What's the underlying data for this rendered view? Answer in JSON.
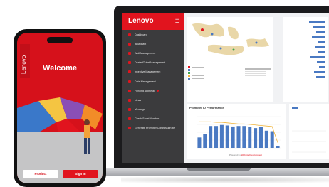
{
  "laptop": {
    "brand": "Lenovo",
    "menu_icon": "hamburger-icon",
    "nav_items": [
      "Dashboard",
      "Broadcast",
      "Wolf Management",
      "Dealer/Outlet Management",
      "Incentive Management",
      "Data Management",
      "Funding Approval",
      "News",
      "Message",
      "Check Serial Number",
      "Generate Promoter Commission file"
    ],
    "chart_panel": {
      "title": "Promoter ID Performance",
      "footer_prefix": "Powered by",
      "footer_link": "Website Development"
    }
  },
  "phone": {
    "brand": "Lenovo",
    "welcome": "Welcome",
    "product_button": "Product",
    "signin_button": "Sign In"
  },
  "colors": {
    "brand_red": "#e1141e",
    "sidebar_bg": "#3b3b3d",
    "bar_blue": "#4a79c2",
    "line_yellow": "#f0b43a"
  },
  "chart_data": {
    "type": "bar",
    "categories": [
      "1",
      "2",
      "3",
      "4",
      "5",
      "6",
      "7",
      "8",
      "9",
      "10",
      "11",
      "12",
      "13",
      "14",
      "15"
    ],
    "series": [
      {
        "values": [
          20,
          26,
          42,
          42,
          44,
          43,
          41,
          42,
          42,
          40,
          38,
          40,
          33,
          32,
          3
        ]
      },
      {
        "values": [
          50,
          50,
          50,
          49,
          49,
          48,
          47,
          46,
          46,
          45,
          44,
          43,
          42,
          41,
          10
        ]
      }
    ],
    "ylim": [
      0,
      60
    ],
    "grid": true
  }
}
